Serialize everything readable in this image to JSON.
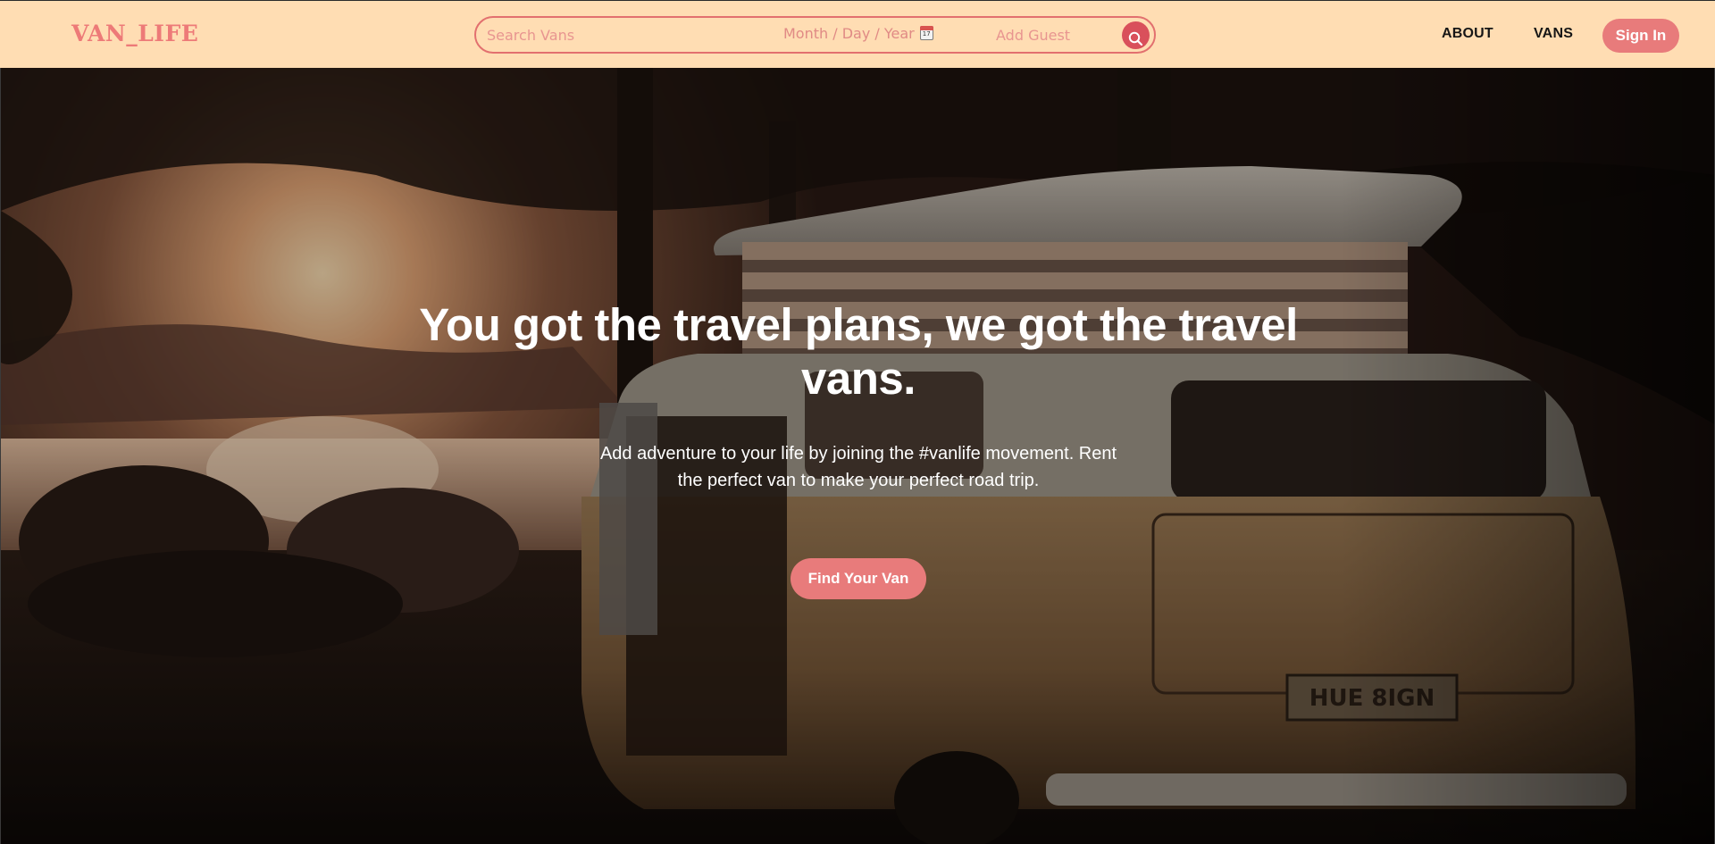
{
  "header": {
    "logo": "VAN_LIFE",
    "search": {
      "vans_placeholder": "Search Vans",
      "date_placeholder": "Month / Day / Year",
      "calendar_icon_day": "17",
      "guest_placeholder": "Add Guest",
      "search_icon": "magnifier-icon"
    },
    "nav": {
      "about": "ABOUT",
      "vans": "VANS",
      "signin": "Sign In"
    }
  },
  "hero": {
    "title": "You got the travel plans, we got the travel vans.",
    "subtitle": "Add adventure to your life by joining the #vanlife movement. Rent the perfect van to make your perfect road trip.",
    "cta": "Find Your Van"
  },
  "colors": {
    "header_bg": "#ffddb3",
    "accent": "#e87b7b",
    "search_button": "#d9505b",
    "nav_text": "#161616",
    "hero_text": "#ffffff"
  }
}
